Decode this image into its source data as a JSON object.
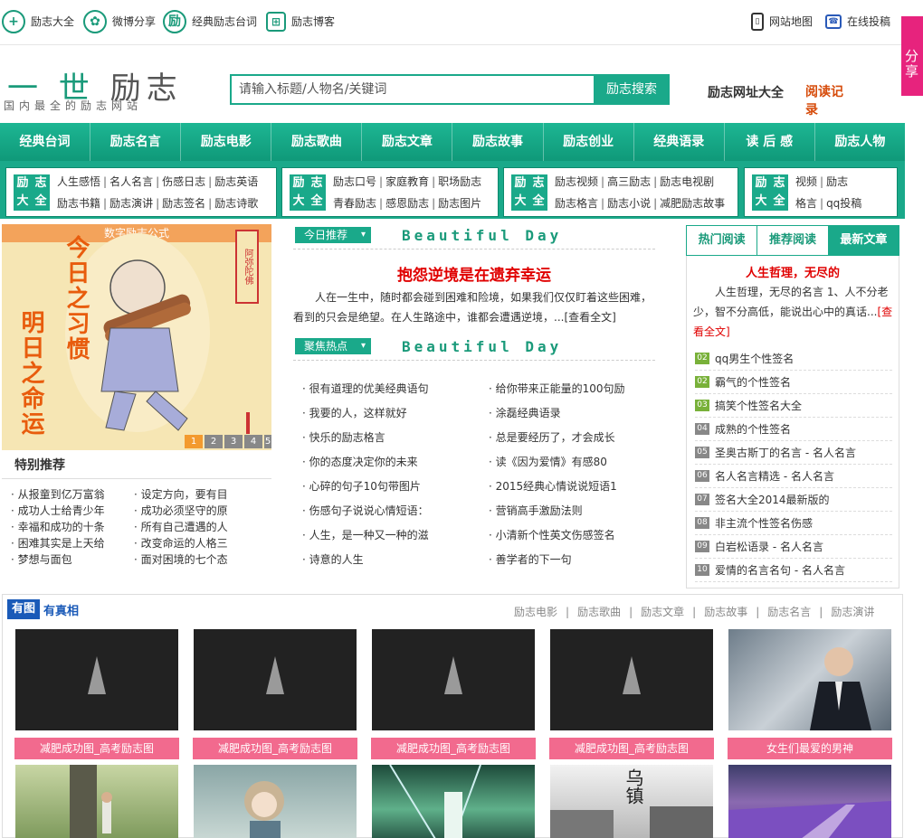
{
  "topbar": {
    "links": [
      "励志大全",
      "微博分享",
      "经典励志台词",
      "励志博客"
    ],
    "right_links": [
      "网站地图",
      "在线投稿"
    ]
  },
  "share_tab": "分享",
  "logo": {
    "main_a": "一 世",
    "main_b": "励志",
    "sub": "国内最全的励志网站"
  },
  "search": {
    "placeholder": "请输入标题/人物名/关键词",
    "button": "励志搜索"
  },
  "header_links": {
    "site_nav": "励志网址大全",
    "reading": "阅读记录"
  },
  "mainnav": [
    "经典台词",
    "励志名言",
    "励志电影",
    "励志歌曲",
    "励志文章",
    "励志故事",
    "励志创业",
    "经典语录",
    "读 后 感",
    "励志人物"
  ],
  "subboxes": [
    {
      "label": [
        "励",
        "志",
        "大",
        "全"
      ],
      "row1": [
        "人生感悟",
        "名人名言",
        "伤感日志",
        "励志英语"
      ],
      "row2": [
        "励志书籍",
        "励志演讲",
        "励志签名",
        "励志诗歌"
      ]
    },
    {
      "label": [
        "励",
        "志",
        "大",
        "全"
      ],
      "row1": [
        "励志口号",
        "家庭教育",
        "职场励志"
      ],
      "row2": [
        "青春励志",
        "感恩励志",
        "励志图片"
      ]
    },
    {
      "label": [
        "励",
        "志",
        "大",
        "全"
      ],
      "row1": [
        "励志视频",
        "高三励志",
        "励志电视剧"
      ],
      "row2": [
        "励志格言",
        "励志小说",
        "减肥励志故事"
      ]
    },
    {
      "label": [
        "励",
        "志",
        "大",
        "全"
      ],
      "row1": [
        "视频",
        "励志"
      ],
      "row2": [
        "格言",
        "qq投稿"
      ]
    }
  ],
  "banner": {
    "title": "数字励志公式",
    "left_text": "明日之命运",
    "right_text": "今日之习惯",
    "seal": "阿弥陀佛",
    "pager": [
      "1",
      "2",
      "3",
      "4",
      "5"
    ]
  },
  "special": {
    "title": "特别推荐",
    "col1": [
      "从报童到亿万富翁",
      "成功人士给青少年",
      "幸福和成功的十条",
      "困难其实是上天给",
      "梦想与面包"
    ],
    "col2": [
      "设定方向，要有目",
      "成功必须坚守的原",
      "所有自己遭遇的人",
      "改变命运的人格三",
      "面对困境的七个态"
    ]
  },
  "center": {
    "tag1": "今日推荐",
    "tag2": "聚焦热点",
    "beautiful": "Beautiful Day",
    "headline": "抱怨逆境是在遗弃幸运",
    "summary": "人在一生中，随时都会碰到困难和险境，如果我们仅仅盯着这些困难，看到的只会是绝望。在人生路途中，谁都会遭遇逆境，...[查看全文]",
    "hot_col1": [
      "很有道理的优美经典语句",
      "我要的人，这样就好",
      "快乐的励志格言",
      "你的态度决定你的未来",
      "心碎的句子10句带图片",
      "伤感句子说说心情短语：",
      "人生，是一种又一种的滋",
      "诗意的人生"
    ],
    "hot_col2": [
      "给你带来正能量的100句励",
      "涂磊经典语录",
      "总是要经历了，才会成长",
      "读《因为爱情》有感80",
      "2015经典心情说说短语1",
      "营销高手激励法则",
      "小清新个性英文伤感签名",
      "善学者的下一句"
    ]
  },
  "right": {
    "tabs": [
      "热门阅读",
      "推荐阅读",
      "最新文章"
    ],
    "headline": "人生哲理，无尽的",
    "summary": "人生哲理，无尽的名言 1、人不分老少，智不分高低，能说出心中的真话...",
    "more": "[查看全文]",
    "ranks": [
      {
        "num": "02",
        "text": "qq男生个性签名"
      },
      {
        "num": "02",
        "text": "霸气的个性签名"
      },
      {
        "num": "03",
        "text": "搞笑个性签名大全"
      },
      {
        "num": "04",
        "text": "成熟的个性签名"
      },
      {
        "num": "05",
        "text": "圣奥古斯丁的名言 - 名人名言"
      },
      {
        "num": "06",
        "text": "名人名言精选 - 名人名言"
      },
      {
        "num": "07",
        "text": "签名大全2014最新版的"
      },
      {
        "num": "08",
        "text": "非主流个性签名伤感"
      },
      {
        "num": "09",
        "text": "白岩松语录 - 名人名言"
      },
      {
        "num": "10",
        "text": "爱情的名言名句 - 名人名言"
      }
    ]
  },
  "photos": {
    "tag1": "有图",
    "tag2": "有真相",
    "cats": [
      "励志电影",
      "励志歌曲",
      "励志文章",
      "励志故事",
      "励志名言",
      "励志演讲"
    ],
    "captions": [
      "减肥成功图_高考励志图",
      "减肥成功图_高考励志图",
      "减肥成功图_高考励志图",
      "减肥成功图_高考励志图",
      "女生们最爱的男神"
    ],
    "row2_sign": "乌镇"
  },
  "colors": {
    "brand": "#1aa98a",
    "accent_red": "#e00000",
    "share": "#e7237d",
    "caption": "#f26a8e"
  }
}
